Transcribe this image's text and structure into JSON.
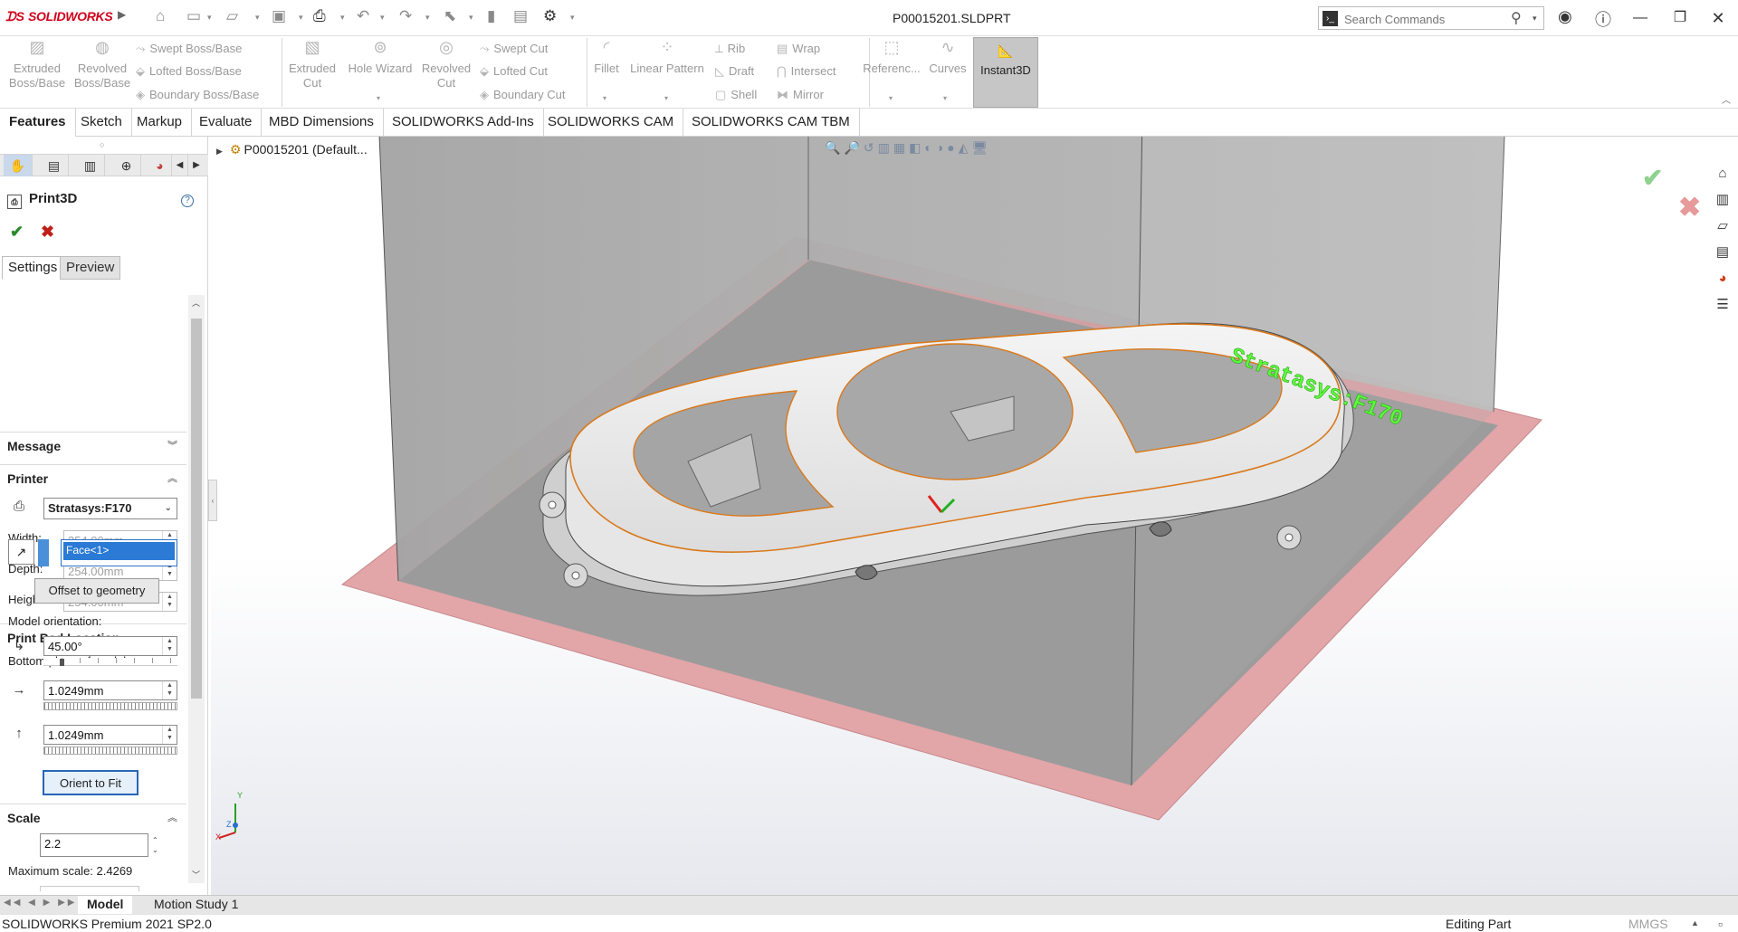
{
  "app": {
    "brand": "SOLIDWORKS",
    "file_title": "P00015201.SLDPRT"
  },
  "search": {
    "placeholder": "Search Commands"
  },
  "ribbon": {
    "extruded_boss": "Extruded\nBoss/Base",
    "revolved_boss": "Revolved\nBoss/Base",
    "swept_boss": "Swept Boss/Base",
    "lofted_boss": "Lofted Boss/Base",
    "boundary_boss": "Boundary Boss/Base",
    "extruded_cut": "Extruded\nCut",
    "hole_wizard": "Hole Wizard",
    "revolved_cut": "Revolved\nCut",
    "swept_cut": "Swept Cut",
    "lofted_cut": "Lofted Cut",
    "boundary_cut": "Boundary Cut",
    "fillet": "Fillet",
    "linear_pattern": "Linear Pattern",
    "rib": "Rib",
    "draft": "Draft",
    "shell": "Shell",
    "wrap": "Wrap",
    "intersect": "Intersect",
    "mirror": "Mirror",
    "reference": "Referenc...",
    "curves": "Curves",
    "instant3d": "Instant3D"
  },
  "tabs": [
    "Features",
    "Sketch",
    "Markup",
    "Evaluate",
    "MBD Dimensions",
    "SOLIDWORKS Add-Ins",
    "SOLIDWORKS CAM",
    "SOLIDWORKS CAM TBM"
  ],
  "pm": {
    "title": "Print3D",
    "subtabs": [
      "Settings",
      "Preview"
    ],
    "message_header": "Message",
    "printer_header": "Printer",
    "printer_value": "Stratasys:F170",
    "width_label": "Width:",
    "width_value": "254.00mm",
    "depth_label": "Depth:",
    "depth_value": "254.00mm",
    "height_label": "Height:",
    "height_value": "254.00mm",
    "bed_header": "Print Bed Location",
    "bottom_plane_label": "Bottom plane of model:",
    "face_value": "Face<1>",
    "offset_button": "Offset to geometry",
    "orientation_label": "Model orientation:",
    "angle_value": "45.00°",
    "x_offset_value": "1.0249mm",
    "y_offset_value": "1.0249mm",
    "orient_button": "Orient to Fit",
    "scale_header": "Scale",
    "scale_value": "2.2",
    "max_scale": "Maximum scale: 2.4269"
  },
  "viewport": {
    "tree_root": "P00015201",
    "tree_config": "(Default...",
    "printer_text": "Stratasys:F170"
  },
  "bottom_tabs": [
    "Model",
    "Motion Study 1"
  ],
  "status": {
    "product": "SOLIDWORKS Premium 2021 SP2.0",
    "mode": "Editing Part",
    "units": "MMGS"
  },
  "colors": {
    "accent": "#2a7ad6",
    "brand_red": "#d0021b",
    "bed_pink": "#e2a5a8",
    "printer_text": "#5dfc3b",
    "edge_orange": "#d9791c"
  }
}
